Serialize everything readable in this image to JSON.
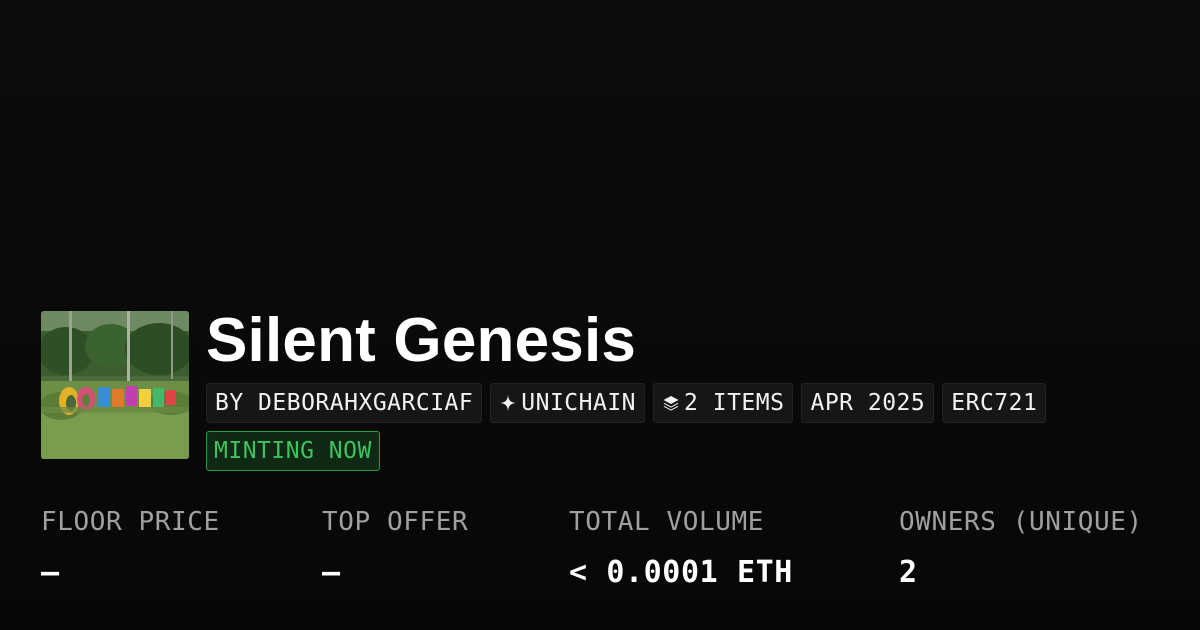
{
  "collection": {
    "title": "Silent Genesis",
    "thumbnail_alt": "Colorful letters sculpture in a grassy park with trees",
    "badges": [
      {
        "label": "BY DEBORAHXGARCIAF",
        "icon": ""
      },
      {
        "label": "UNICHAIN",
        "icon": "sparkle-icon"
      },
      {
        "label": "2 ITEMS",
        "icon": "layers-icon"
      },
      {
        "label": "APR 2025",
        "icon": ""
      },
      {
        "label": "ERC721",
        "icon": ""
      }
    ],
    "status": "MINTING NOW"
  },
  "stats": [
    {
      "label": "FLOOR PRICE",
      "value": "—"
    },
    {
      "label": "TOP OFFER",
      "value": "—"
    },
    {
      "label": "TOTAL VOLUME",
      "value": "< 0.0001 ETH"
    },
    {
      "label": "OWNERS (UNIQUE)",
      "value": "2"
    }
  ],
  "colors": {
    "background": "#0b0b0b",
    "chip_background": "#161616",
    "status_green": "#3fc25e",
    "status_border": "#2a9a44",
    "label_gray": "#a0a0a0"
  }
}
